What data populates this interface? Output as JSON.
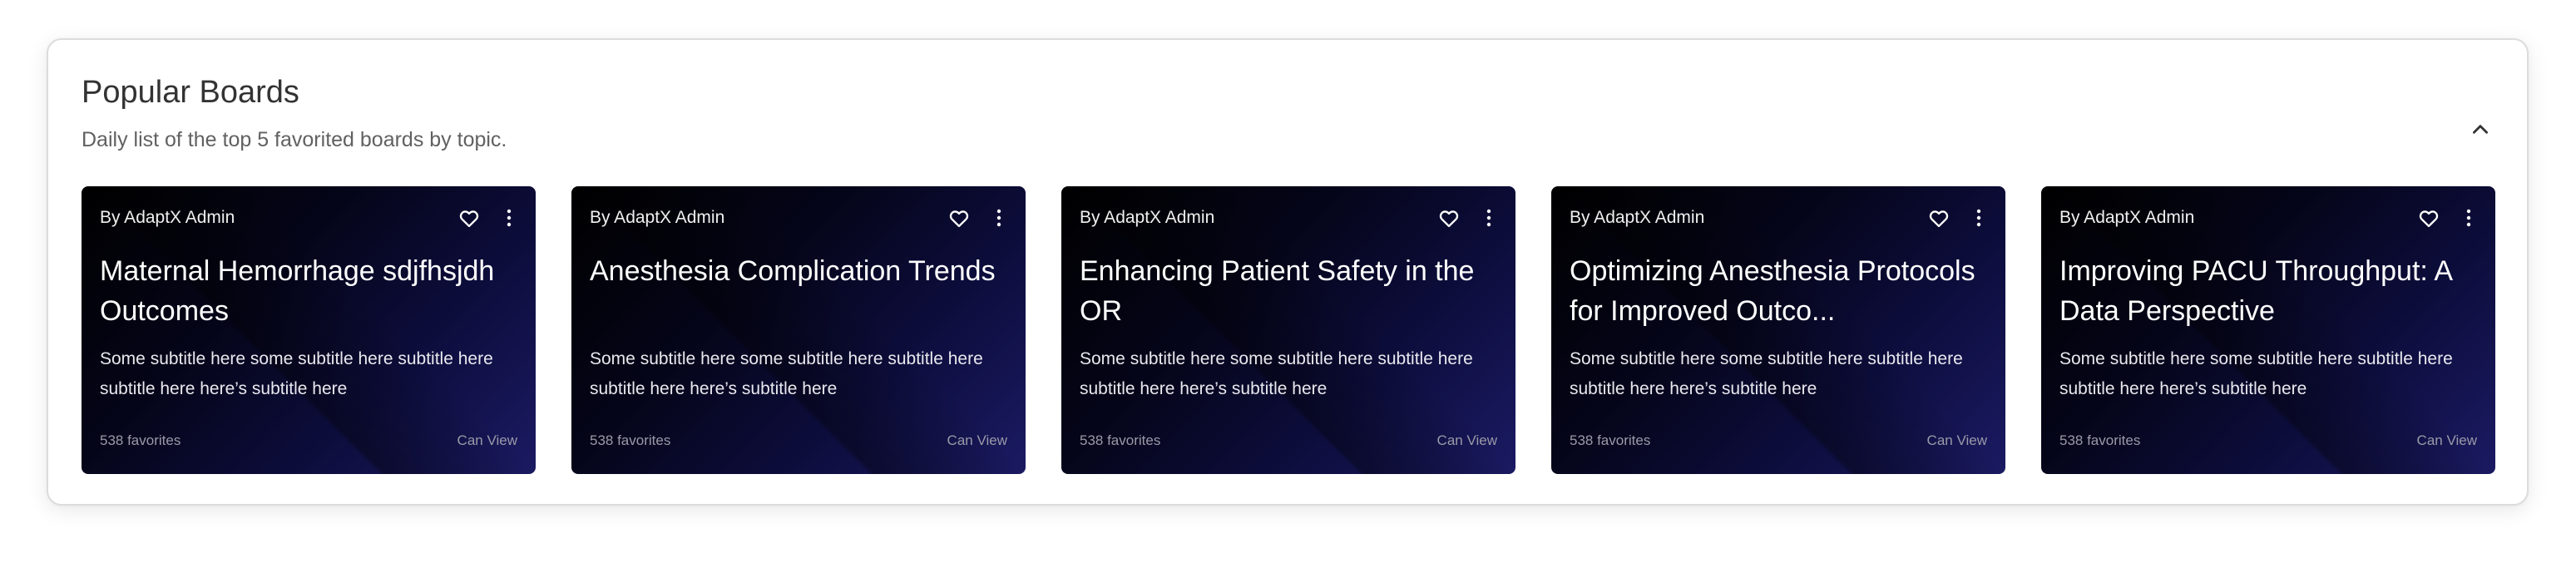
{
  "section": {
    "title": "Popular Boards",
    "subtitle": "Daily list of the top 5 favorited boards by topic.",
    "collapse_icon": "chevron-up-icon"
  },
  "cards": [
    {
      "author": "By AdaptX Admin",
      "title": "Maternal Hemorrhage sdjfhsjdh Outcomes",
      "subtitle": "Some subtitle here some subtitle here subtitle here subtitle here here’s subtitle here",
      "favorites": "538 favorites",
      "access": "Can View"
    },
    {
      "author": "By AdaptX Admin",
      "title": "Anesthesia Complication Trends",
      "subtitle": "Some subtitle here some subtitle here subtitle here subtitle here here’s subtitle here",
      "favorites": "538 favorites",
      "access": "Can View"
    },
    {
      "author": "By AdaptX Admin",
      "title": "Enhancing Patient Safety in the OR",
      "subtitle": "Some subtitle here some subtitle here subtitle here subtitle here here’s subtitle here",
      "favorites": "538 favorites",
      "access": "Can View"
    },
    {
      "author": "By AdaptX Admin",
      "title": "Optimizing Anesthesia Protocols for Improved Outco...",
      "subtitle": "Some subtitle here some subtitle here subtitle here subtitle here here’s subtitle here",
      "favorites": "538 favorites",
      "access": "Can View"
    },
    {
      "author": "By AdaptX Admin",
      "title": "Improving PACU Throughput: A Data Perspective",
      "subtitle": "Some subtitle here some subtitle here subtitle here subtitle here here’s subtitle here",
      "favorites": "538 favorites",
      "access": "Can View"
    }
  ],
  "icons": {
    "favorite": "heart-icon",
    "menu": "more-vert-icon"
  },
  "colors": {
    "card_gradient_start": "#000000",
    "card_gradient_end": "#1b1a63",
    "muted_text": "#9a9aa8"
  }
}
